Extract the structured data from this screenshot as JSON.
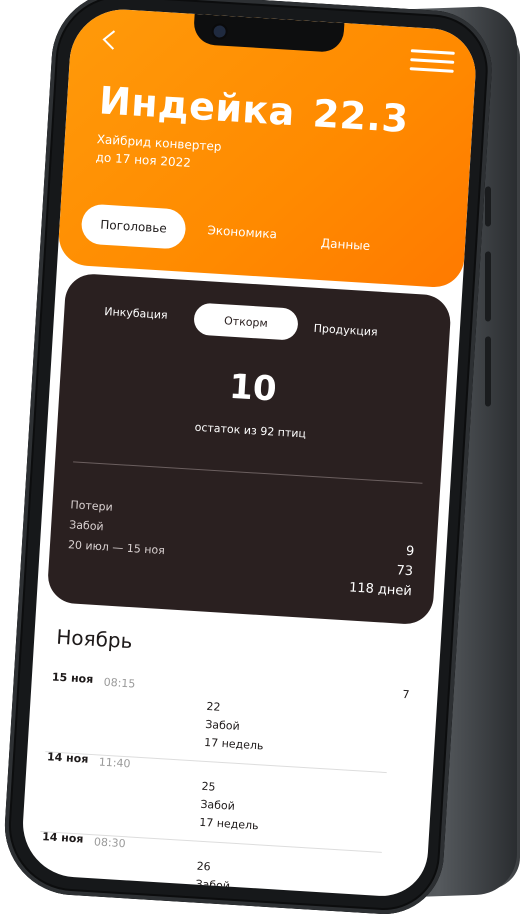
{
  "header": {
    "title": "Индейка",
    "title_value": "22.3",
    "subtitle_line1": "Хайбрид конвертер",
    "subtitle_line2": "до 17 ноя 2022",
    "tabs": [
      {
        "label": "Поголовье",
        "active": true
      },
      {
        "label": "Экономика",
        "active": false
      },
      {
        "label": "Данные",
        "active": false
      }
    ]
  },
  "card": {
    "segments": [
      {
        "label": "Инкубация",
        "active": false
      },
      {
        "label": "Откорм",
        "active": true
      },
      {
        "label": "Продукция",
        "active": false
      }
    ],
    "remaining": "10",
    "remaining_caption": "остаток из 92 птиц",
    "stats": {
      "losses_label": "Потери",
      "slaughter_label": "Забой",
      "period_label": "20 июл — 15 ноя",
      "losses_value": "9",
      "slaughter_value": "73",
      "days_value": "118 дней"
    }
  },
  "list": {
    "month": "Ноябрь",
    "rows": [
      {
        "date": "15 ноя",
        "time": "08:15",
        "count": "22",
        "kind": "Забой",
        "duration": "17 недель",
        "right": "7"
      },
      {
        "date": "14 ноя",
        "time": "11:40",
        "count": "25",
        "kind": "Забой",
        "duration": "17 недель",
        "right": ""
      },
      {
        "date": "14 ноя",
        "time": "08:30",
        "count": "26",
        "kind": "Забой",
        "duration": "",
        "right": ""
      }
    ]
  },
  "colors": {
    "accent": "#ff8a00",
    "card_bg": "#2a2020",
    "text_dark": "#1e1a1a"
  },
  "icons": {
    "back": "chevron-left-icon",
    "menu": "hamburger-menu-icon",
    "camera": "camera-icon"
  }
}
